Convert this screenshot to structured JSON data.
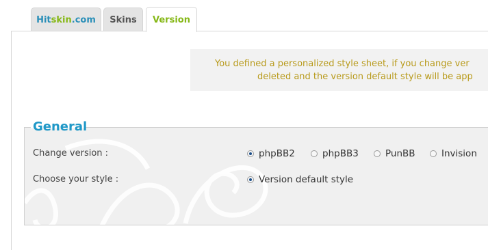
{
  "tabs": {
    "hitskin_a": "Hit",
    "hitskin_b": "skin",
    "hitskin_c": ".com",
    "skins": "Skins",
    "version": "Version"
  },
  "notice": {
    "line1": "You defined a personalized style sheet, if you change ver",
    "line2": "deleted and the version default style will be app"
  },
  "general": {
    "legend": "General",
    "change_version_label": "Change version :",
    "versions": [
      {
        "label": "phpBB2",
        "checked": true
      },
      {
        "label": "phpBB3",
        "checked": false
      },
      {
        "label": "PunBB",
        "checked": false
      },
      {
        "label": "Invision",
        "checked": false
      }
    ],
    "choose_style_label": "Choose your style :",
    "style_option": "Version default style"
  },
  "colors": {
    "accent_blue": "#1f98c7",
    "accent_green": "#86b817",
    "notice_text": "#b89a1a"
  }
}
